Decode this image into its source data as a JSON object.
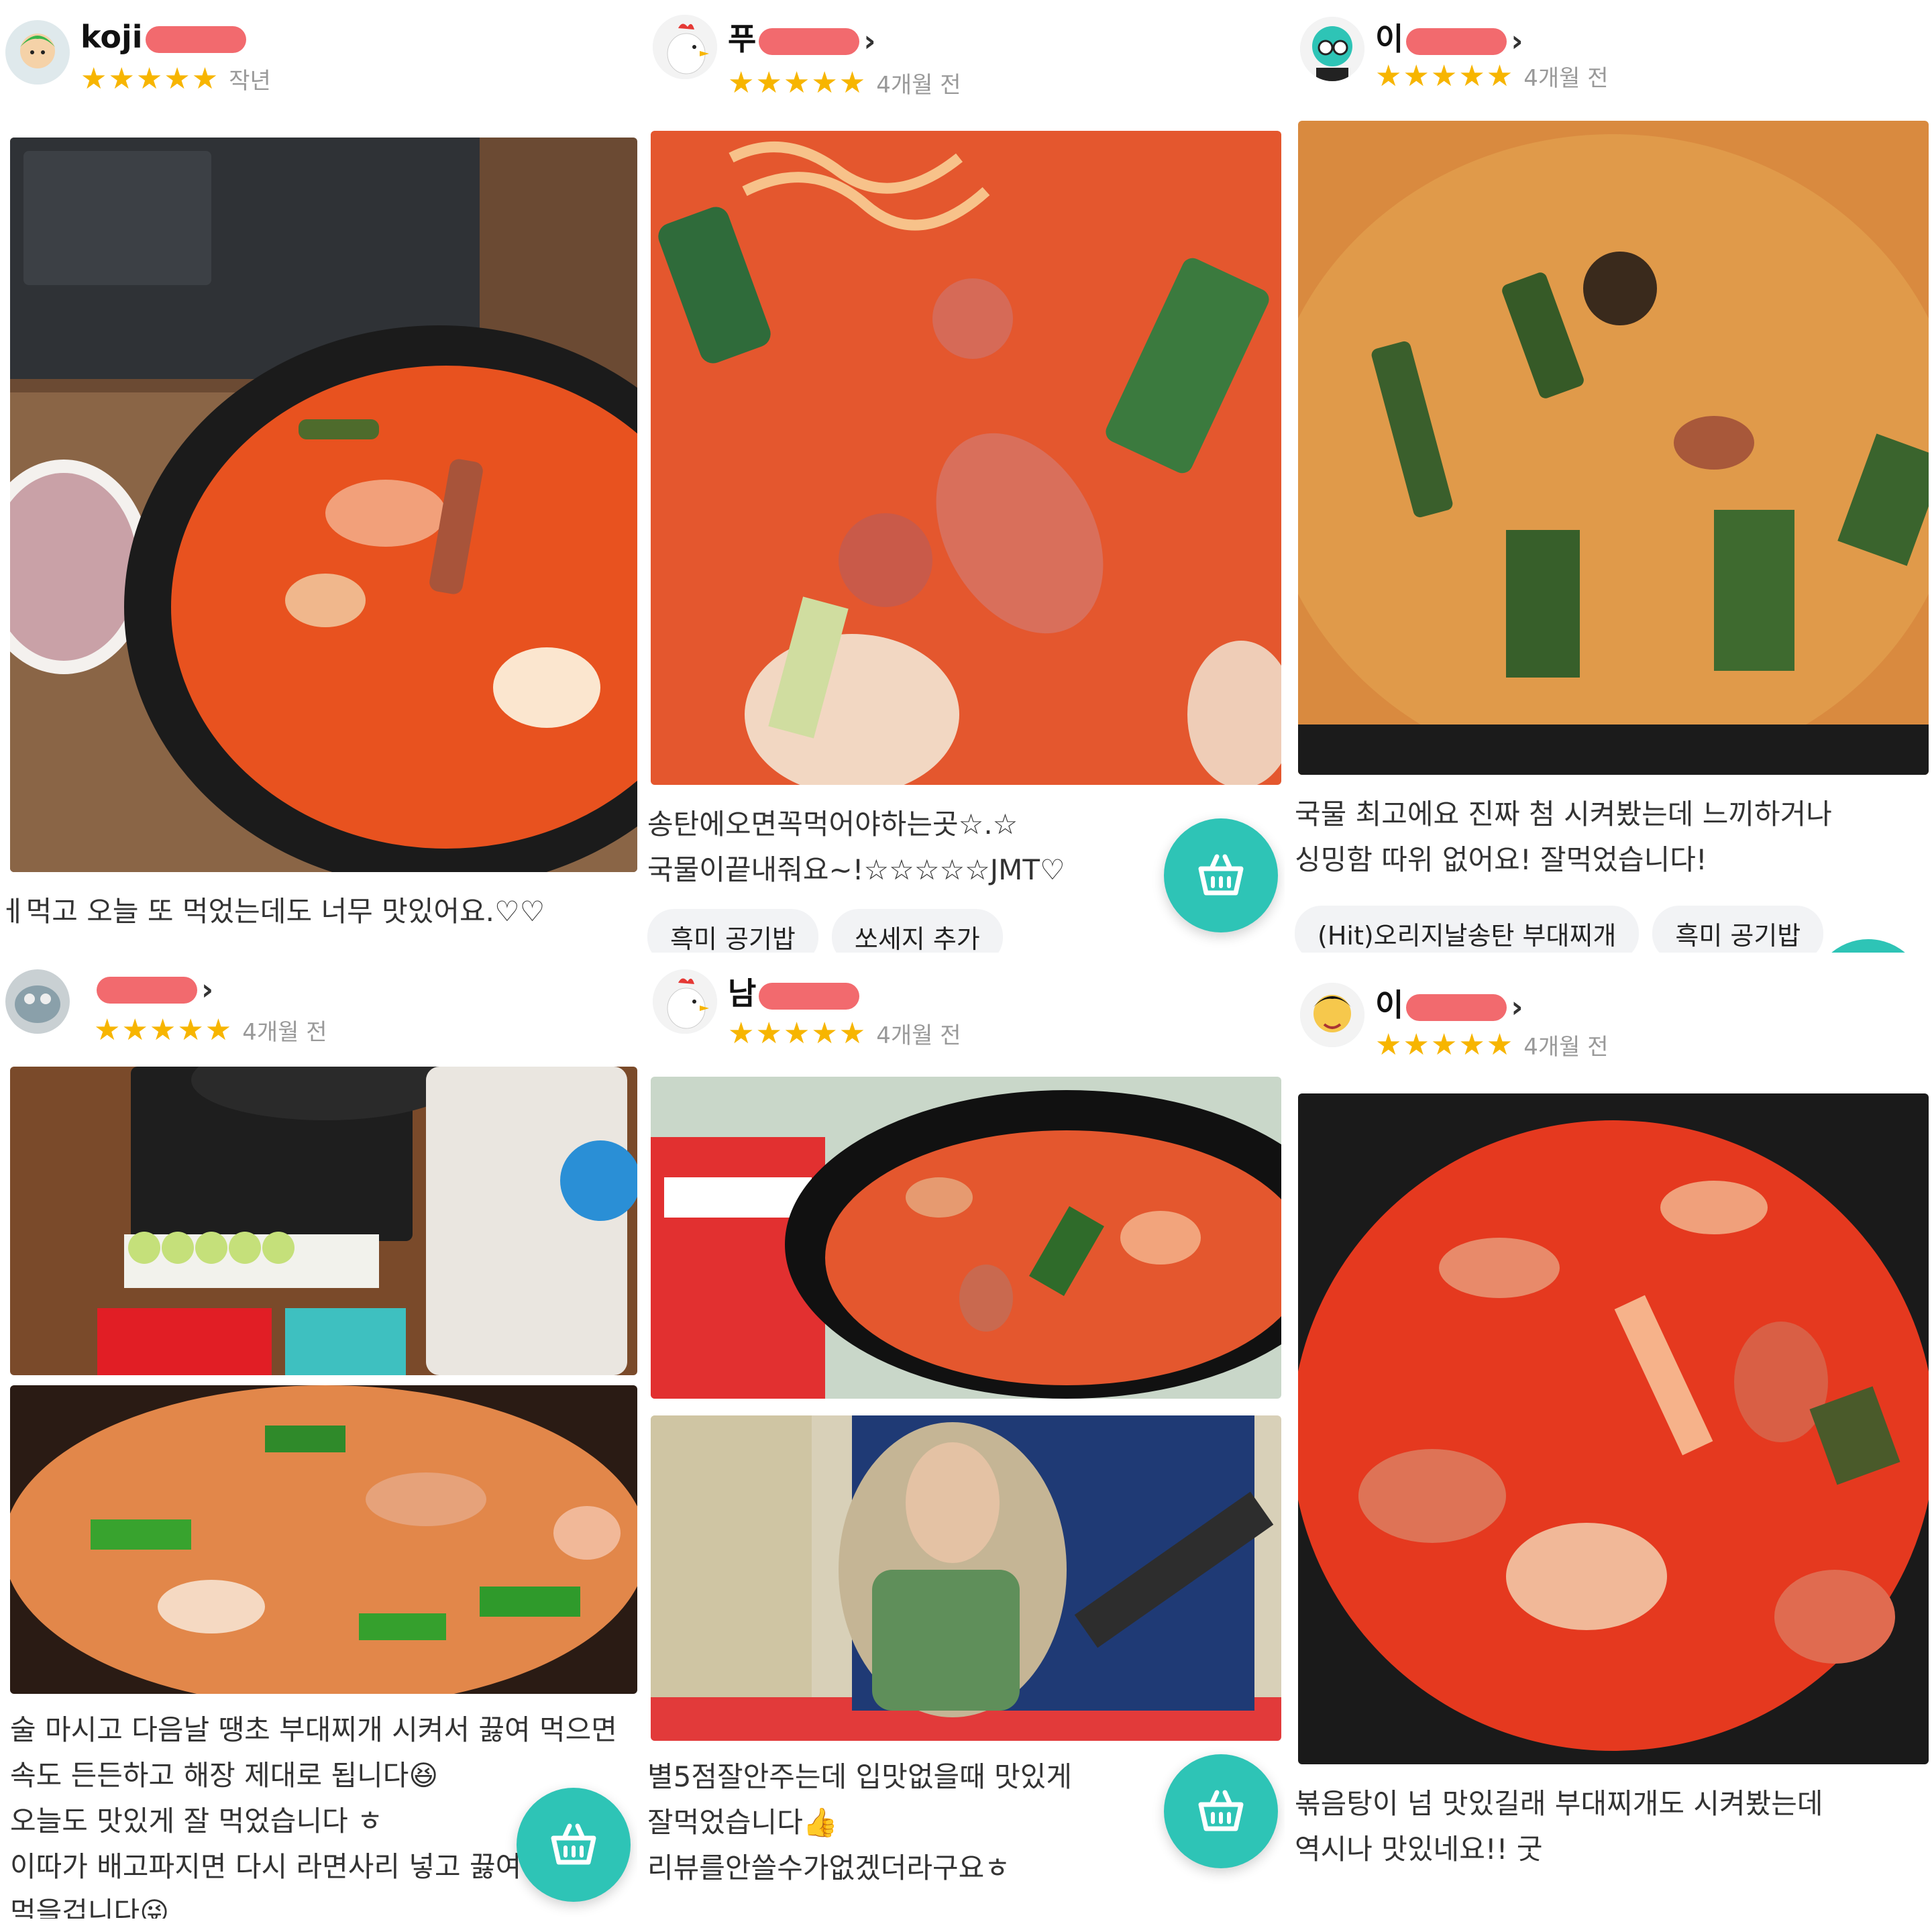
{
  "colors": {
    "accent": "#2ec4b6",
    "star": "#f7b500",
    "redaction": "#f26a6e"
  },
  "reviews": [
    {
      "name": "koji",
      "stars": "★★★★★",
      "time": "작년",
      "text": [
        "ㅔ먹고 오늘 또 먹었는데도 너무 맛있어요.♡♡"
      ],
      "chips": [],
      "photo": "budae-jjigae-with-rice"
    },
    {
      "name": "푸",
      "stars": "★★★★★",
      "time": "4개월 전",
      "text": [
        "송탄에오면꼭먹어야하는곳☆.☆",
        "국물이끝내줘요~!☆☆☆☆☆JMT♡"
      ],
      "chips": [
        "흑미 공기밥",
        "쏘세지 추가"
      ],
      "photo": "budae-jjigae-closeup"
    },
    {
      "name": "이",
      "stars": "★★★★★",
      "time": "4개월 전",
      "text": [
        "국물 최고에요 진짜 첨 시켜봤는데 느끼하거나",
        "싱밍함 따위 없어요! 잘먹었습니다!"
      ],
      "chips": [
        "(Hit)오리지날송탄 부대찌개",
        "흑미 공기밥"
      ],
      "photo": "budae-jjigae-closeup-2"
    },
    {
      "name": "",
      "stars": "★★★★★",
      "time": "4개월 전",
      "text": [
        "술 마시고 다음날 땡초 부대찌개 시켜서 끓여 먹으면",
        "속도 든든하고 해장 제대로 됩니다😆",
        "오늘도 맛있게 잘 먹었습니다 ㅎ",
        "이따가 배고파지면 다시 라면사리 넣고 끓여",
        "먹을겁니다😜"
      ],
      "chips": [],
      "photo": "stove-and-pan"
    },
    {
      "name": "남",
      "stars": "★★★★★",
      "time": "4개월 전",
      "text": [
        "별5점잘안주는데 입맛없을때 맛있게",
        "잘먹었습니다👍",
        "리뷰를안쓸수가없겠더라구요ㅎ"
      ],
      "chips": [],
      "photo": "delivery-bowl-with-ramen"
    },
    {
      "name": "이",
      "stars": "★★★★★",
      "time": "4개월 전",
      "text": [
        "볶음탕이 넘 맛있길래 부대찌개도 시켜봤는데",
        "역시나 맛있네요!! 굿"
      ],
      "chips": [],
      "photo": "delivery-bowl-closeup"
    }
  ]
}
